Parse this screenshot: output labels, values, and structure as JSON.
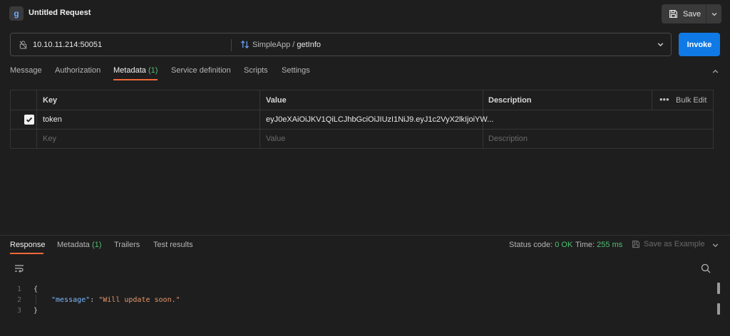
{
  "header": {
    "title": "Untitled Request",
    "logo_glyph": "g",
    "save_label": "Save"
  },
  "url_bar": {
    "address": "10.10.11.214:50051",
    "service": "SimpleApp",
    "separator": " / ",
    "method": "getInfo"
  },
  "invoke_label": "Invoke",
  "request_tabs": [
    {
      "label": "Message"
    },
    {
      "label": "Authorization"
    },
    {
      "label": "Metadata",
      "count": "(1)",
      "active": true
    },
    {
      "label": "Service definition"
    },
    {
      "label": "Scripts"
    },
    {
      "label": "Settings"
    }
  ],
  "metadata_table": {
    "headers": {
      "key": "Key",
      "value": "Value",
      "description": "Description"
    },
    "bulk_edit_label": "Bulk Edit",
    "rows": [
      {
        "checked": true,
        "key": "token",
        "value": "eyJ0eXAiOiJKV1QiLCJhbGciOiJIUzI1NiJ9.eyJ1c2VyX2lkIjoiYW...",
        "description": ""
      }
    ],
    "placeholders": {
      "key": "Key",
      "value": "Value",
      "description": "Description"
    }
  },
  "response_tabs": [
    {
      "label": "Response",
      "active": true
    },
    {
      "label": "Metadata",
      "count": "(1)"
    },
    {
      "label": "Trailers"
    },
    {
      "label": "Test results"
    }
  ],
  "status": {
    "code_label": "Status code:",
    "code_value": "0 OK",
    "time_label": "Time:",
    "time_value": "255 ms",
    "save_example_label": "Save as Example"
  },
  "response_body": {
    "line_numbers": [
      "1",
      "2",
      "3"
    ],
    "open_brace": "{",
    "key": "\"message\"",
    "colon": ": ",
    "value": "\"Will update soon.\"",
    "close_brace": "}"
  },
  "colors": {
    "background": "#1e1e1e",
    "accent": "#ef6a36",
    "primary_button": "#0f7ae5",
    "success": "#4fbf73"
  }
}
